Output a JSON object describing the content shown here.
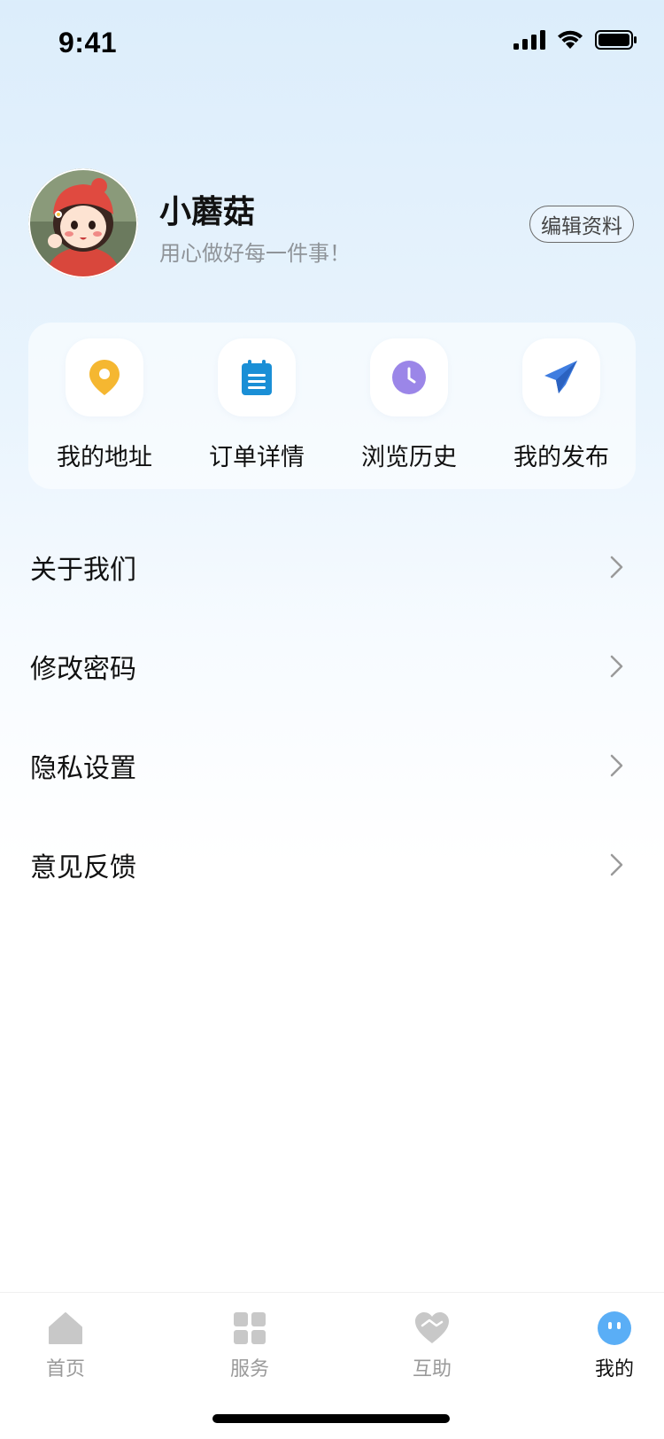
{
  "status_bar": {
    "time": "9:41"
  },
  "profile": {
    "name": "小蘑菇",
    "motto": "用心做好每一件事！",
    "edit_label": "编辑资料"
  },
  "quick_actions": [
    {
      "label": "我的地址",
      "icon": "location-pin-icon",
      "color": "#f5b731"
    },
    {
      "label": "订单详情",
      "icon": "clipboard-icon",
      "color": "#1a8fd6"
    },
    {
      "label": "浏览历史",
      "icon": "clock-icon",
      "color": "#9b86e8"
    },
    {
      "label": "我的发布",
      "icon": "paper-plane-icon",
      "color": "#3f7de0"
    }
  ],
  "menu": [
    {
      "label": "关于我们"
    },
    {
      "label": "修改密码"
    },
    {
      "label": "隐私设置"
    },
    {
      "label": "意见反馈"
    }
  ],
  "tab_bar": {
    "items": [
      {
        "label": "首页",
        "icon": "home-icon",
        "active": false
      },
      {
        "label": "服务",
        "icon": "grid-icon",
        "active": false
      },
      {
        "label": "互助",
        "icon": "heart-handshake-icon",
        "active": false
      },
      {
        "label": "我的",
        "icon": "profile-face-icon",
        "active": true
      }
    ],
    "active_color": "#5aaef6",
    "inactive_color": "#c8c8c8"
  }
}
